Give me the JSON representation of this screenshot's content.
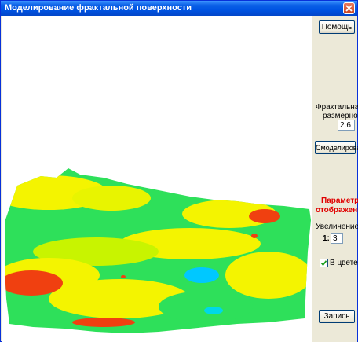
{
  "window": {
    "title": "Моделирование фрактальной поверхности"
  },
  "panel": {
    "help_label": "Помощь",
    "fractal_label_line1": "Фрактальная",
    "fractal_label_line2": "размерность",
    "fractal_value": "2.6",
    "model_label": "Смоделировать",
    "display_params_line1": "Параметры",
    "display_params_line2": "отображения",
    "zoom_label": "Увеличение",
    "zoom_prefix": "1:",
    "zoom_value": "3",
    "color_checkbox_label": "В цвете",
    "color_checked": true,
    "record_label": "Запись"
  },
  "colors": {
    "title_bar": "#0054e3",
    "panel_bg": "#ece9d8",
    "params_heading": "#e00000",
    "terrain_low": "#00c8ff",
    "terrain_mid_low": "#2ee05a",
    "terrain_mid": "#66ee22",
    "terrain_high": "#f4f400",
    "terrain_peak": "#f04010"
  },
  "icons": {
    "close": "close-icon",
    "checkmark": "checkmark-icon"
  }
}
